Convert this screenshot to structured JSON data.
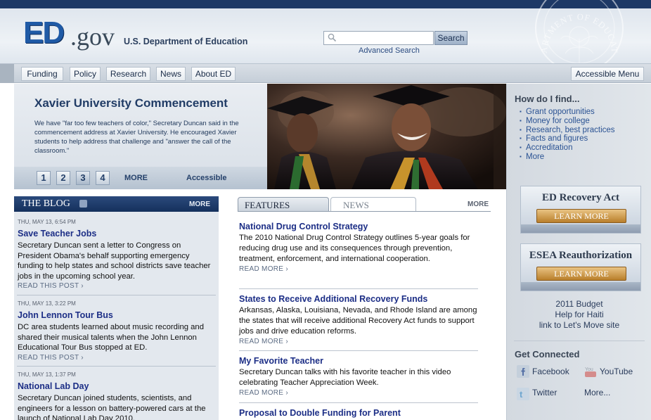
{
  "header": {
    "logo_ed": "ED",
    "logo_gov": ".gov",
    "department": "U.S. Department of Education",
    "search_placeholder": "",
    "search_button": "Search",
    "advanced_search": "Advanced Search",
    "seal_text": "DEPARTMENT OF EDUCATION"
  },
  "nav": {
    "items": [
      "Funding",
      "Policy",
      "Research",
      "News",
      "About ED"
    ],
    "accessible_menu": "Accessible Menu"
  },
  "feature": {
    "title": "Xavier University Commencement",
    "description": "We have \"far too few teachers of color,\" Secretary Duncan said in the commencement address at Xavier University. He encouraged Xavier students to help address that challenge and \"answer the call of the classroom.\"",
    "slides": [
      "1",
      "2",
      "3",
      "4"
    ],
    "active_slide": 3,
    "more": "MORE",
    "accessible": "Accessible"
  },
  "howdo": {
    "title": "How do I find...",
    "items": [
      "Grant opportunities",
      "Money for college",
      "Research, best practices",
      "Facts and figures",
      "Accreditation",
      "More"
    ]
  },
  "promos": [
    {
      "title": "ED Recovery Act",
      "button": "LEARN MORE"
    },
    {
      "title": "ESEA Reauthorization",
      "button": "LEARN MORE"
    }
  ],
  "right_links": [
    "2011 Budget",
    "Help for Haiti",
    "link to Let's Move site"
  ],
  "connected": {
    "title": "Get Connected",
    "facebook": "Facebook",
    "youtube": "YouTube",
    "twitter": "Twitter",
    "more": "More..."
  },
  "blog": {
    "title": "THE BLOG",
    "more": "MORE",
    "posts": [
      {
        "date": "THU, MAY 13, 6:54 PM",
        "title": "Save Teacher Jobs",
        "text": "Secretary Duncan sent a letter to Congress on President Obama's behalf supporting emergency funding to help states and school districts save teacher jobs in the upcoming school year.",
        "more": "READ THIS POST ›"
      },
      {
        "date": "THU, MAY 13, 3:22 PM",
        "title": "John Lennon Tour Bus",
        "text": "DC area students learned about music recording and shared their musical talents when the John Lennon Educational Tour Bus stopped at ED.",
        "more": "READ THIS POST ›"
      },
      {
        "date": "THU, MAY 13, 1:37 PM",
        "title": "National Lab Day",
        "text": "Secretary Duncan joined students, scientists, and engineers for a lesson on battery-powered cars at the launch of National Lab Day 2010.",
        "more": ""
      }
    ]
  },
  "features": {
    "tab_features": "FEATURES",
    "tab_news": "NEWS",
    "more": "MORE",
    "items": [
      {
        "title": "National Drug Control Strategy",
        "text": "The 2010 National Drug Control Strategy outlines 5-year goals for reducing drug use and its consequences through prevention, treatment, enforcement, and international cooperation.",
        "more": "READ MORE ›"
      },
      {
        "title": "States to Receive Additional Recovery Funds",
        "text": "Arkansas, Alaska, Louisiana, Nevada, and Rhode Island are among the states that will receive additional Recovery Act funds to support jobs and drive education reforms.",
        "more": "READ MORE ›"
      },
      {
        "title": "My Favorite Teacher",
        "text": "Secretary Duncan talks with his favorite teacher in this video celebrating Teacher Appreciation Week.",
        "more": "READ MORE ›"
      },
      {
        "title": "Proposal to Double Funding for Parent",
        "text": "",
        "more": ""
      }
    ]
  }
}
